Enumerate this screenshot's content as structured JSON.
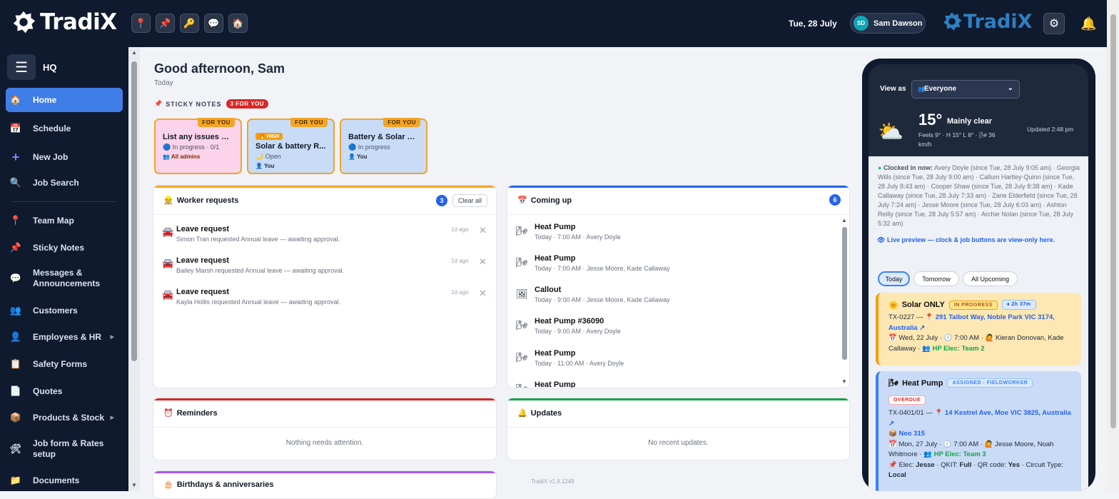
{
  "app": {
    "name": "TradiX",
    "date": "Tue, 28 July",
    "user": {
      "initials": "SD",
      "name": "Sam Dawson"
    },
    "brand_right": "TradiX",
    "quick_icons": [
      "pin-icon",
      "pushpin-icon",
      "key-icon",
      "chat-icon",
      "home-icon"
    ]
  },
  "sidebar": {
    "title": "HQ",
    "items": [
      {
        "label": "Home",
        "icon": "home-icon"
      },
      {
        "label": "Schedule",
        "icon": "calendar-icon"
      },
      {
        "label": "New Job",
        "icon": "plus-icon"
      },
      {
        "label": "Job Search",
        "icon": "search-icon"
      },
      {
        "label": "Team Map",
        "icon": "pin-icon"
      },
      {
        "label": "Sticky Notes",
        "icon": "pushpin-icon"
      },
      {
        "label": "Messages & Announcements",
        "icon": "chat-icon"
      },
      {
        "label": "Customers",
        "icon": "people-icon"
      },
      {
        "label": "Employees & HR",
        "icon": "person-icon"
      },
      {
        "label": "Safety Forms",
        "icon": "clipboard-icon"
      },
      {
        "label": "Quotes",
        "icon": "document-icon"
      },
      {
        "label": "Products & Stock",
        "icon": "box-icon"
      },
      {
        "label": "Job form & Rates setup",
        "icon": "tools-icon"
      },
      {
        "label": "Documents",
        "icon": "folder-icon"
      }
    ]
  },
  "main": {
    "greeting": "Good afternoon, Sam",
    "today": "Today",
    "sticky": {
      "title": "STICKY NOTES",
      "badge": "3 FOR YOU",
      "notes": [
        {
          "tag": "FOR YOU",
          "title": "List any issues or ...",
          "status": "In progress · 0/1",
          "who": "All admins",
          "color": "#fbd3ea"
        },
        {
          "tag": "FOR YOU",
          "priority": "HIGH",
          "title": "Solar & battery R...",
          "status": "Open",
          "who": "You",
          "color": "#c8dcf8"
        },
        {
          "tag": "FOR YOU",
          "title": "Battery & Solar C...",
          "status": "In progress",
          "who": "You",
          "color": "#c8dcf8"
        }
      ]
    },
    "worker_requests": {
      "title": "Worker requests",
      "count": "3",
      "clear": "Clear all",
      "items": [
        {
          "title": "Leave request",
          "desc": "Simon Tran requested Annual leave — awaiting approval.",
          "age": "1d ago"
        },
        {
          "title": "Leave request",
          "desc": "Bailey Marsh requested Annual leave — awaiting approval.",
          "age": "1d ago"
        },
        {
          "title": "Leave request",
          "desc": "Kayla Hollis requested Annual leave — awaiting approval.",
          "age": "1d ago"
        }
      ]
    },
    "coming_up": {
      "title": "Coming up",
      "count": "6",
      "items": [
        {
          "title": "Heat Pump",
          "desc": "Today · 7:00 AM · Avery Doyle"
        },
        {
          "title": "Heat Pump",
          "desc": "Today · 7:00 AM · Jesse Moore, Kade Callaway"
        },
        {
          "title": "Callout",
          "desc": "Today · 9:00 AM · Jesse Moore, Kade Callaway"
        },
        {
          "title": "Heat Pump #36090",
          "desc": "Today · 9:00 AM · Avery Doyle"
        },
        {
          "title": "Heat Pump",
          "desc": "Today · 11:00 AM · Avery Doyle"
        },
        {
          "title": "Heat Pump",
          "desc": ""
        }
      ]
    },
    "reminders": {
      "title": "Reminders",
      "empty": "Nothing needs attention."
    },
    "updates": {
      "title": "Updates",
      "empty": "No recent updates."
    },
    "birthdays": {
      "title": "Birthdays & anniversaries"
    },
    "version": "TradiX v1.9.1249"
  },
  "phone": {
    "view_as_label": "View as",
    "view_as_value": "Everyone",
    "weather": {
      "temp": "15°",
      "cond": "Mainly clear",
      "feels": "Feels 9° · H 15° L 8° · 🌬 36 km/h",
      "updated": "Updated 2:48 pm"
    },
    "clocked_label": "Clocked in now:",
    "clocked_text": "Avery Doyle (since Tue, 28 July 9:05 am) · Georgia Wills (since Tue, 28 July 9:00 am) · Callum Hartley-Quinn (since Tue, 28 July 8:43 am) · Cooper Shaw (since Tue, 28 July 8:38 am) · Kade Callaway (since Tue, 28 July 7:33 am) · Zane Elderfield (since Tue, 28 July 7:24 am) · Jesse Moore (since Tue, 28 July 6:03 am) · Ashton Reilly (since Tue, 28 July 5:57 am) · Archie Nolan (since Tue, 28 July 5:32 am)",
    "preview": "Live preview — clock & job buttons are view-only here.",
    "tabs": [
      "Today",
      "Tomorrow",
      "All Upcoming"
    ],
    "jobs": [
      {
        "title": "Solar ONLY",
        "status": "IN PROGRESS",
        "timer": "2h 37m",
        "code": "TX-0227 —",
        "address": "291 Talbot Way, Noble Park VIC 3174, Australia ↗",
        "date": "Wed, 22 July ·",
        "time": "7:00 AM ·",
        "workers": "Kieran Donovan, Kade Callaway ·",
        "team": "HP Elec: Team 2"
      },
      {
        "title": "Heat Pump",
        "status": "ASSIGNED - FIELDWORKER",
        "overdue": "OVERDUE",
        "code": "TX-0401/01 —",
        "address": "14 Kestrel Ave, Moe VIC 3825, Australia ↗",
        "product": "Neo 315",
        "date": "Mon, 27 July ·",
        "time": "7:00 AM ·",
        "workers": "Jesse Moore, Noah Whitmore ·",
        "team": "HP Elec: Team 3",
        "elec_label": "Elec:",
        "elec": "Jesse",
        "qkit_label": "· QKIT:",
        "qkit": "Full",
        "qr_label": "· QR code:",
        "qr": "Yes",
        "circuit_label": "· Circuit Type:",
        "circuit": "Local"
      }
    ]
  }
}
